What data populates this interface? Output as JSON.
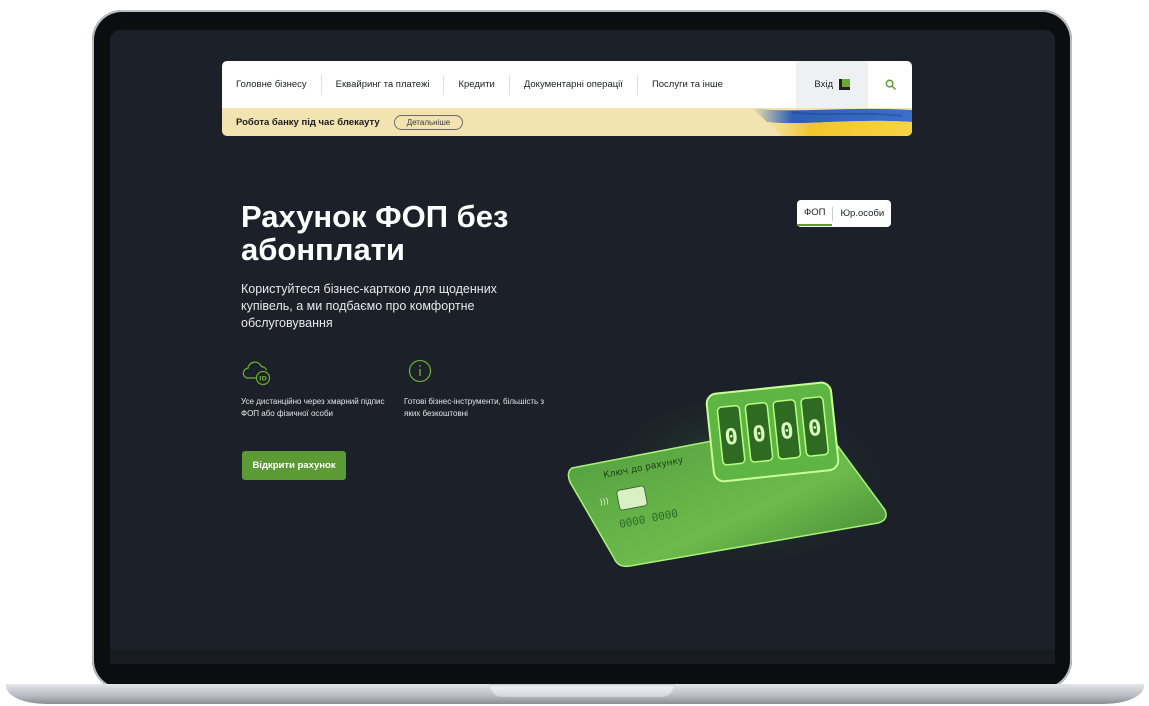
{
  "nav": {
    "items": [
      "Головне бізнесу",
      "Еквайринг та платежі",
      "Кредити",
      "Документарні операції",
      "Послуги та інше"
    ],
    "login_label": "Вхід"
  },
  "notice": {
    "text": "Робота банку під час блекауту",
    "button": "Детальніше"
  },
  "hero": {
    "title": "Рахунок ФОП без абонплати",
    "description": "Користуйтеся бізнес-карткою для щоденних купівель, а ми подбаємо про комфортне обслуговування",
    "features": [
      "Усе дистанційно через хмарний підпис ФОП або фізичної особи",
      "Готові бізнес-інструменти, більшість з яких безкоштовні"
    ],
    "cta": "Відкрити рахунок"
  },
  "toggle": {
    "options": [
      "ФОП",
      "Юр.особи"
    ],
    "selected": "ФОП"
  },
  "card": {
    "label": "Ключ до рахунку",
    "number": "0000 0000",
    "counter": [
      "0",
      "0",
      "0",
      "0"
    ]
  },
  "colors": {
    "accent": "#5b9a34",
    "page_bg": "#1b2029",
    "notice_bg": "#f2e3b0"
  }
}
